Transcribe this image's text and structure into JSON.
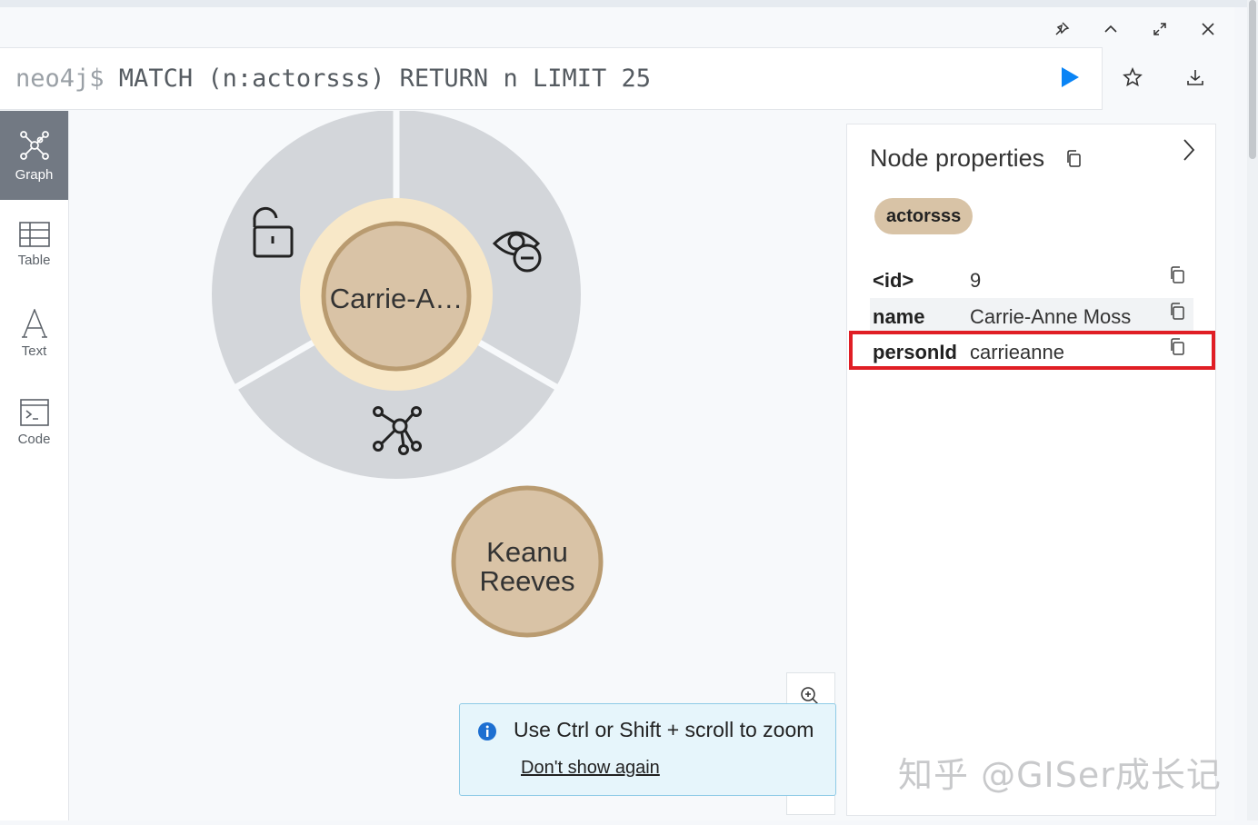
{
  "window": {
    "controls": [
      "pin-icon",
      "chevron-up-icon",
      "expand-icon",
      "close-icon"
    ]
  },
  "editor": {
    "prompt": "neo4j$",
    "query": " MATCH (n:actorsss) RETURN n LIMIT 25",
    "actions": [
      "play-icon",
      "star-icon",
      "download-icon"
    ]
  },
  "sidenav": {
    "items": [
      {
        "label": "Graph",
        "icon": "graph-icon",
        "active": true
      },
      {
        "label": "Table",
        "icon": "table-icon",
        "active": false
      },
      {
        "label": "Text",
        "icon": "text-icon",
        "active": false
      },
      {
        "label": "Code",
        "icon": "code-icon",
        "active": false
      }
    ]
  },
  "graph": {
    "selected_node": {
      "label": "Carrie-A…",
      "ring_actions": [
        "unlock-icon",
        "hide-icon",
        "expand-relationships-icon"
      ]
    },
    "nodes": [
      {
        "label_line1": "Keanu",
        "label_line2": "Reeves"
      }
    ],
    "colors": {
      "node_fill": "#d9c3a6",
      "node_stroke": "#b99b70",
      "selection_ring": "#f8e8c8",
      "menu_fill": "#d3d6da"
    }
  },
  "properties": {
    "title": "Node properties",
    "label_chip": "actorsss",
    "rows": [
      {
        "key": "<id>",
        "value": "9"
      },
      {
        "key": "name",
        "value": "Carrie-Anne Moss"
      },
      {
        "key": "personId",
        "value": "carrieanne"
      }
    ],
    "highlight_color": "#e01e25"
  },
  "toast": {
    "message": "Use Ctrl or Shift + scroll to zoom",
    "action": "Don't show again"
  },
  "watermark": "知乎 @GISer成长记"
}
